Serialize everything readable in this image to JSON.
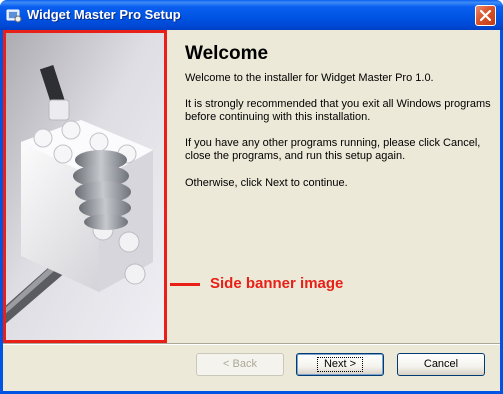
{
  "window": {
    "title": "Widget Master Pro Setup"
  },
  "banner": {
    "callout": "Side banner image"
  },
  "content": {
    "heading": "Welcome",
    "paragraphs": [
      "Welcome to the installer for Widget Master Pro 1.0.",
      "It is strongly recommended that you exit all Windows programs before continuing with this installation.",
      "If you have any other programs running, please click Cancel, close the programs, and run this setup again.",
      "Otherwise, click Next to continue."
    ]
  },
  "buttons": {
    "back": "< Back",
    "next": "Next >",
    "cancel": "Cancel"
  },
  "colors": {
    "annotation": "#e82018",
    "titlebar": "#0054e3",
    "dialog_face": "#ece9d8"
  },
  "icons": [
    "setup-app-icon",
    "close-icon"
  ]
}
